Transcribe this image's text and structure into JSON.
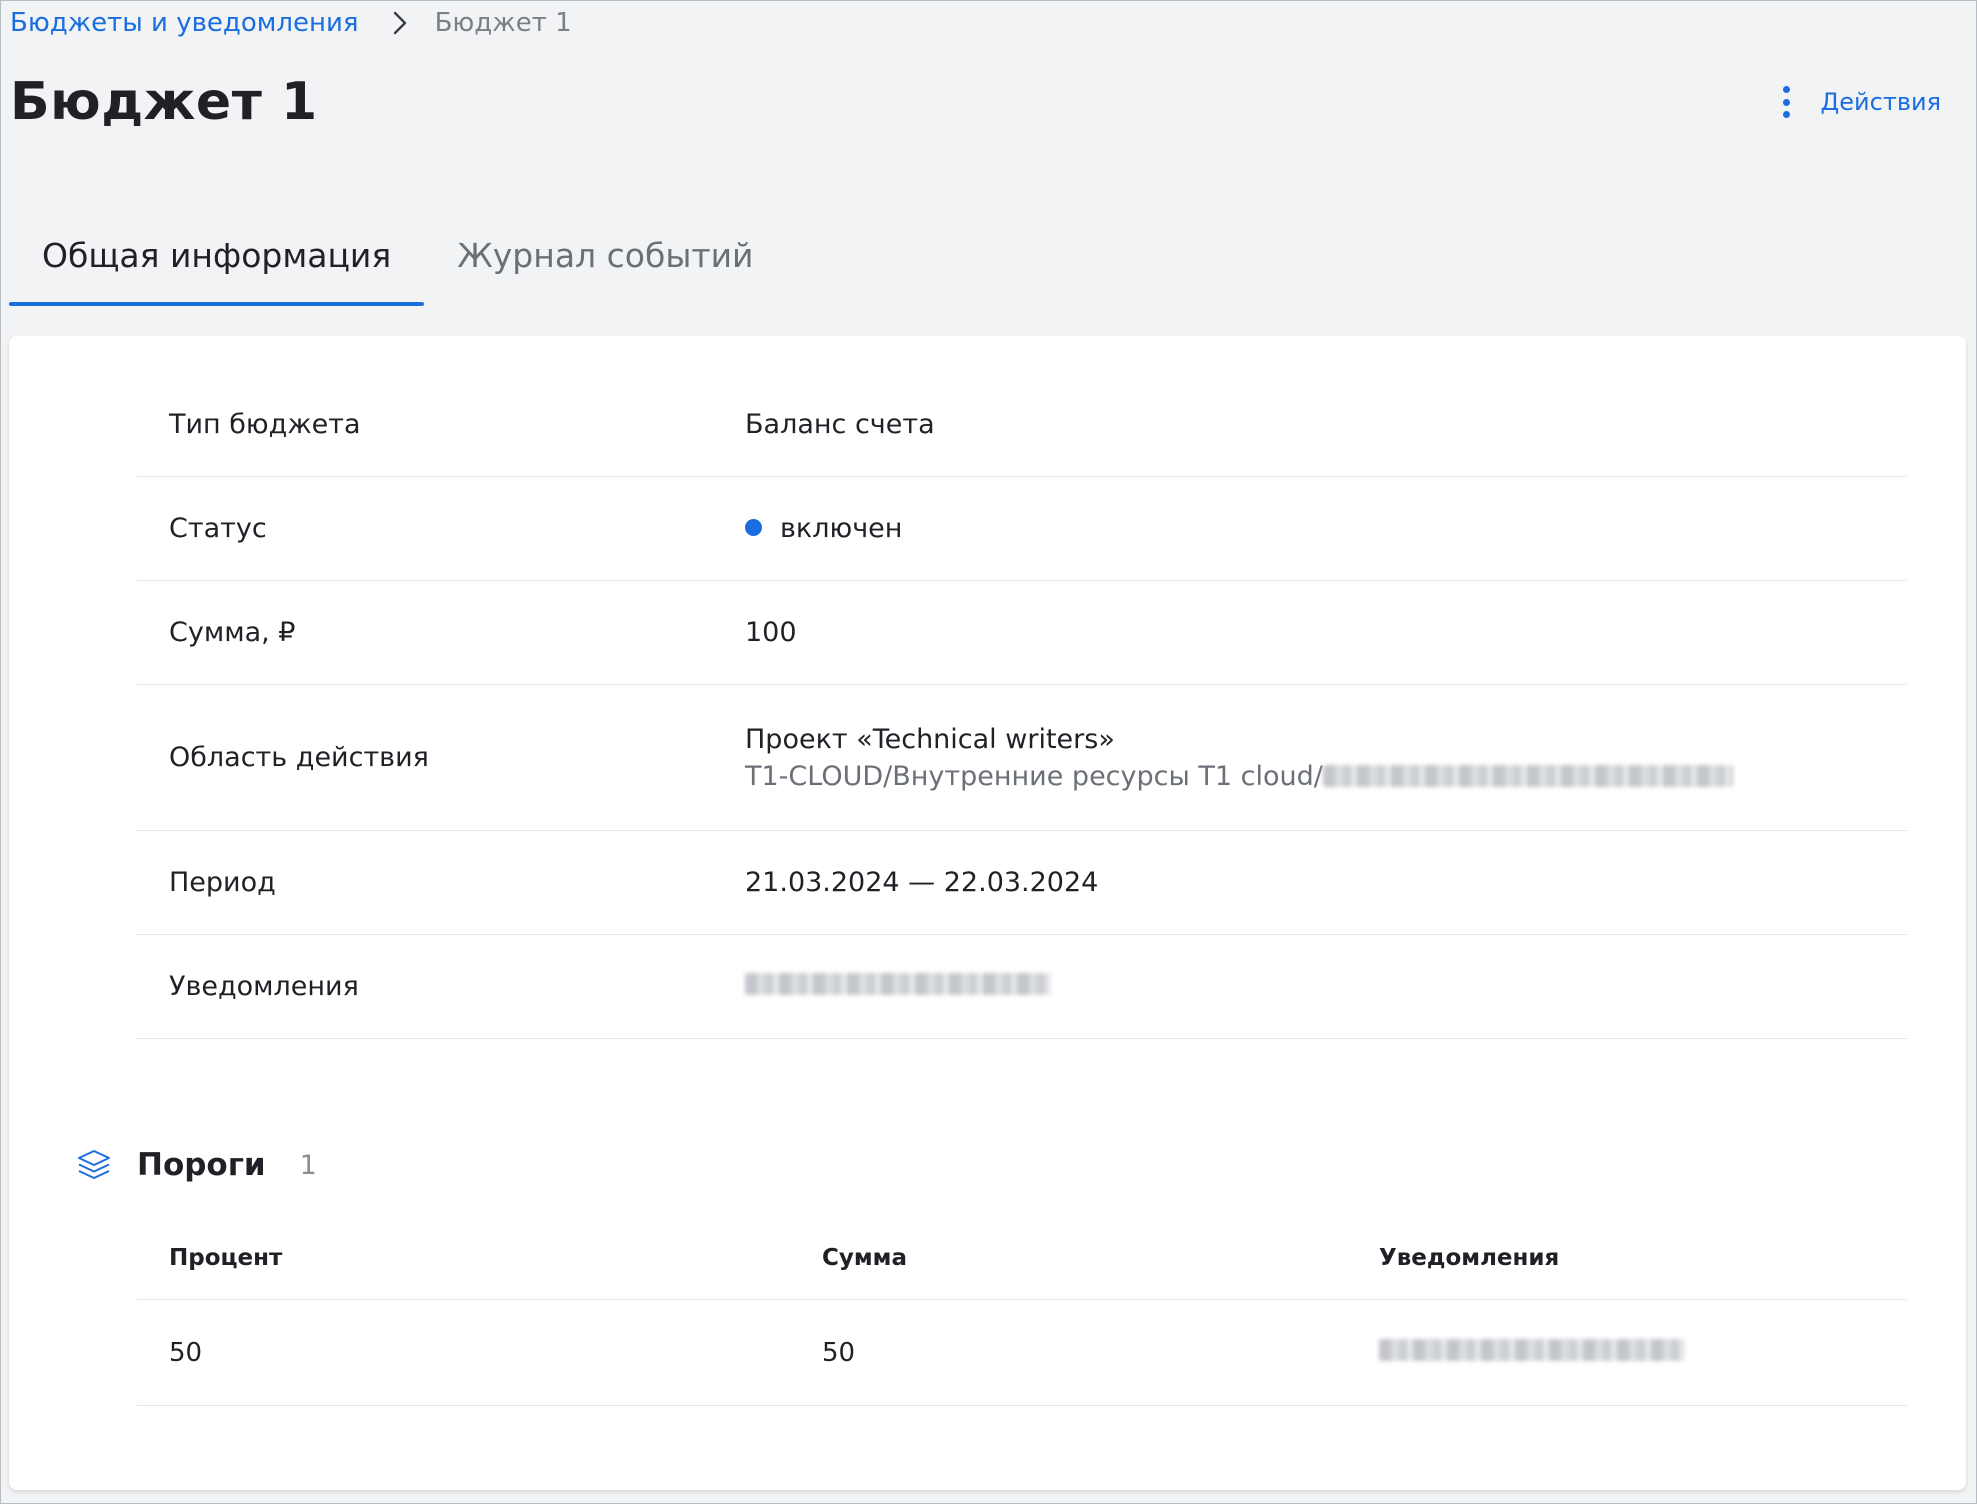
{
  "breadcrumb": {
    "parent": "Бюджеты и уведомления",
    "current": "Бюджет 1"
  },
  "page": {
    "title": "Бюджет 1",
    "actions_label": "Действия"
  },
  "tabs": [
    {
      "label": "Общая информация",
      "active": true
    },
    {
      "label": "Журнал событий",
      "active": false
    }
  ],
  "details": {
    "budget_type": {
      "label": "Тип бюджета",
      "value": "Баланс счета"
    },
    "status": {
      "label": "Статус",
      "value": "включен"
    },
    "amount": {
      "label": "Сумма, ₽",
      "value": "100"
    },
    "scope": {
      "label": "Область действия",
      "value": "Проект «Technical writers»",
      "path": "T1-CLOUD/Внутренние ресурсы T1 cloud/"
    },
    "period": {
      "label": "Период",
      "value": "21.03.2024 — 22.03.2024"
    },
    "notifications": {
      "label": "Уведомления"
    }
  },
  "thresholds": {
    "title": "Пороги",
    "count": "1",
    "columns": [
      "Процент",
      "Сумма",
      "Уведомления"
    ],
    "rows": [
      {
        "percent": "50",
        "amount": "50"
      }
    ]
  },
  "colors": {
    "accent": "#1a6ee0",
    "background": "#f2f3f5",
    "card": "#ffffff"
  },
  "icons": {
    "breadcrumb_separator": "chevron-right-icon",
    "actions": "kebab-menu-icon",
    "thresholds": "layers-icon",
    "status": "status-dot"
  }
}
